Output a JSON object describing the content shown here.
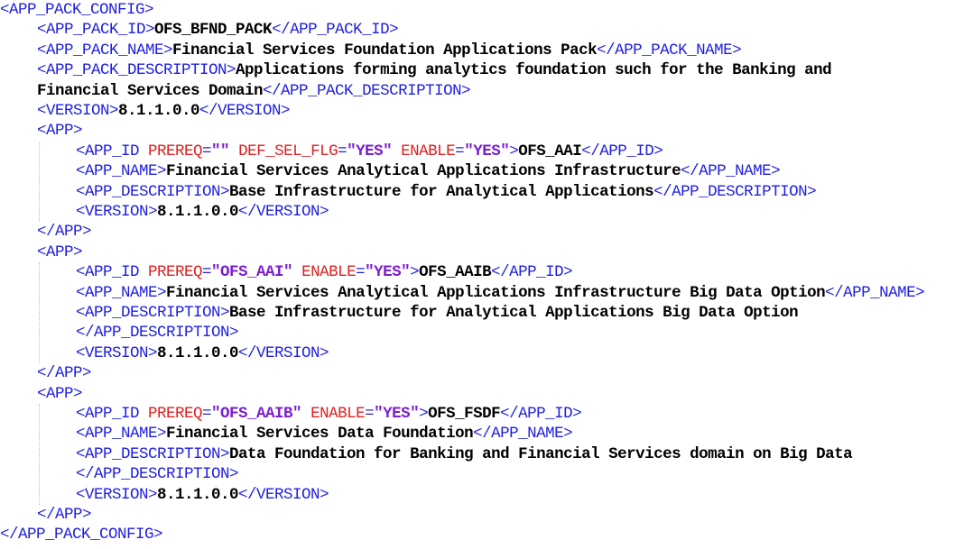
{
  "lines": [
    {
      "indent": 0,
      "tokens": [
        {
          "t": "tag",
          "v": "<APP_PACK_CONFIG>"
        }
      ]
    },
    {
      "indent": 1,
      "tokens": [
        {
          "t": "tag",
          "v": "<APP_PACK_ID>"
        },
        {
          "t": "text",
          "v": "OFS_BFND_PACK"
        },
        {
          "t": "tag",
          "v": "</APP_PACK_ID>"
        }
      ]
    },
    {
      "indent": 1,
      "tokens": [
        {
          "t": "tag",
          "v": "<APP_PACK_NAME>"
        },
        {
          "t": "text",
          "v": "Financial Services Foundation Applications Pack"
        },
        {
          "t": "tag",
          "v": "</APP_PACK_NAME>"
        }
      ]
    },
    {
      "indent": 1,
      "tokens": [
        {
          "t": "tag",
          "v": "<APP_PACK_DESCRIPTION>"
        },
        {
          "t": "text",
          "v": "Applications forming analytics foundation such for the Banking and"
        }
      ]
    },
    {
      "indent": 1,
      "tokens": [
        {
          "t": "text",
          "v": "Financial Services Domain"
        },
        {
          "t": "tag",
          "v": "</APP_PACK_DESCRIPTION>"
        }
      ]
    },
    {
      "indent": 1,
      "tokens": [
        {
          "t": "tag",
          "v": "<VERSION>"
        },
        {
          "t": "text",
          "v": "8.1.1.0.0"
        },
        {
          "t": "tag",
          "v": "</VERSION>"
        }
      ]
    },
    {
      "indent": 1,
      "tokens": [
        {
          "t": "tag",
          "v": "<APP>"
        }
      ]
    },
    {
      "indent": 2,
      "tokens": [
        {
          "t": "tag",
          "v": "<APP_ID "
        },
        {
          "t": "attr",
          "v": "PREREQ"
        },
        {
          "t": "tag",
          "v": "="
        },
        {
          "t": "val",
          "v": "\"\""
        },
        {
          "t": "tag",
          "v": " "
        },
        {
          "t": "attr",
          "v": "DEF_SEL_FLG"
        },
        {
          "t": "tag",
          "v": "="
        },
        {
          "t": "val",
          "v": "\"YES\""
        },
        {
          "t": "tag",
          "v": " "
        },
        {
          "t": "attr",
          "v": "ENABLE"
        },
        {
          "t": "tag",
          "v": "="
        },
        {
          "t": "val",
          "v": "\"YES\""
        },
        {
          "t": "tag",
          "v": ">"
        },
        {
          "t": "text",
          "v": "OFS_AAI"
        },
        {
          "t": "tag",
          "v": "</APP_ID>"
        }
      ]
    },
    {
      "indent": 2,
      "tokens": [
        {
          "t": "tag",
          "v": "<APP_NAME>"
        },
        {
          "t": "text",
          "v": "Financial Services Analytical Applications Infrastructure"
        },
        {
          "t": "tag",
          "v": "</APP_NAME>"
        }
      ]
    },
    {
      "indent": 2,
      "tokens": [
        {
          "t": "tag",
          "v": "<APP_DESCRIPTION>"
        },
        {
          "t": "text",
          "v": "Base Infrastructure for Analytical Applications"
        },
        {
          "t": "tag",
          "v": "</APP_DESCRIPTION>"
        }
      ]
    },
    {
      "indent": 2,
      "tokens": [
        {
          "t": "tag",
          "v": "<VERSION>"
        },
        {
          "t": "text",
          "v": "8.1.1.0.0"
        },
        {
          "t": "tag",
          "v": "</VERSION>"
        }
      ]
    },
    {
      "indent": 1,
      "tokens": [
        {
          "t": "tag",
          "v": "</APP>"
        }
      ]
    },
    {
      "indent": 1,
      "tokens": [
        {
          "t": "tag",
          "v": "<APP>"
        }
      ]
    },
    {
      "indent": 2,
      "tokens": [
        {
          "t": "tag",
          "v": "<APP_ID "
        },
        {
          "t": "attr",
          "v": "PREREQ"
        },
        {
          "t": "tag",
          "v": "="
        },
        {
          "t": "val",
          "v": "\"OFS_AAI\""
        },
        {
          "t": "tag",
          "v": " "
        },
        {
          "t": "attr",
          "v": "ENABLE"
        },
        {
          "t": "tag",
          "v": "="
        },
        {
          "t": "val",
          "v": "\"YES\""
        },
        {
          "t": "tag",
          "v": ">"
        },
        {
          "t": "text",
          "v": "OFS_AAIB"
        },
        {
          "t": "tag",
          "v": "</APP_ID>"
        }
      ]
    },
    {
      "indent": 2,
      "tokens": [
        {
          "t": "tag",
          "v": "<APP_NAME>"
        },
        {
          "t": "text",
          "v": "Financial Services Analytical Applications Infrastructure Big Data Option"
        },
        {
          "t": "tag",
          "v": "</APP_NAME>"
        }
      ]
    },
    {
      "indent": 2,
      "tokens": [
        {
          "t": "tag",
          "v": "<APP_DESCRIPTION>"
        },
        {
          "t": "text",
          "v": "Base Infrastructure for Analytical Applications Big Data Option"
        }
      ]
    },
    {
      "indent": 2,
      "tokens": [
        {
          "t": "tag",
          "v": "</APP_DESCRIPTION>"
        }
      ]
    },
    {
      "indent": 2,
      "tokens": [
        {
          "t": "tag",
          "v": "<VERSION>"
        },
        {
          "t": "text",
          "v": "8.1.1.0.0"
        },
        {
          "t": "tag",
          "v": "</VERSION>"
        }
      ]
    },
    {
      "indent": 1,
      "tokens": [
        {
          "t": "tag",
          "v": "</APP>"
        }
      ]
    },
    {
      "indent": 1,
      "tokens": [
        {
          "t": "tag",
          "v": "<APP>"
        }
      ]
    },
    {
      "indent": 2,
      "tokens": [
        {
          "t": "tag",
          "v": "<APP_ID "
        },
        {
          "t": "attr",
          "v": "PREREQ"
        },
        {
          "t": "tag",
          "v": "="
        },
        {
          "t": "val",
          "v": "\"OFS_AAIB\""
        },
        {
          "t": "tag",
          "v": " "
        },
        {
          "t": "attr",
          "v": "ENABLE"
        },
        {
          "t": "tag",
          "v": "="
        },
        {
          "t": "val",
          "v": "\"YES\""
        },
        {
          "t": "tag",
          "v": ">"
        },
        {
          "t": "text",
          "v": "OFS_FSDF"
        },
        {
          "t": "tag",
          "v": "</APP_ID>"
        }
      ]
    },
    {
      "indent": 2,
      "tokens": [
        {
          "t": "tag",
          "v": "<APP_NAME>"
        },
        {
          "t": "text",
          "v": "Financial Services Data Foundation"
        },
        {
          "t": "tag",
          "v": "</APP_NAME>"
        }
      ]
    },
    {
      "indent": 2,
      "tokens": [
        {
          "t": "tag",
          "v": "<APP_DESCRIPTION>"
        },
        {
          "t": "text",
          "v": "Data Foundation for Banking and Financial Services domain on Big Data"
        }
      ]
    },
    {
      "indent": 2,
      "tokens": [
        {
          "t": "tag",
          "v": "</APP_DESCRIPTION>"
        }
      ]
    },
    {
      "indent": 2,
      "tokens": [
        {
          "t": "tag",
          "v": "<VERSION>"
        },
        {
          "t": "text",
          "v": "8.1.1.0.0"
        },
        {
          "t": "tag",
          "v": "</VERSION>"
        }
      ]
    },
    {
      "indent": 1,
      "tokens": [
        {
          "t": "tag",
          "v": "</APP>"
        }
      ]
    },
    {
      "indent": 0,
      "tokens": [
        {
          "t": "tag",
          "v": "</APP_PACK_CONFIG>"
        }
      ]
    }
  ],
  "colors": {
    "tag": "#1f1fe0",
    "attribute": "#e01f1f",
    "attribute_value": "#7a1fd0",
    "text": "#000000",
    "indent_guide": "#bdbdbd",
    "background": "#ffffff"
  }
}
